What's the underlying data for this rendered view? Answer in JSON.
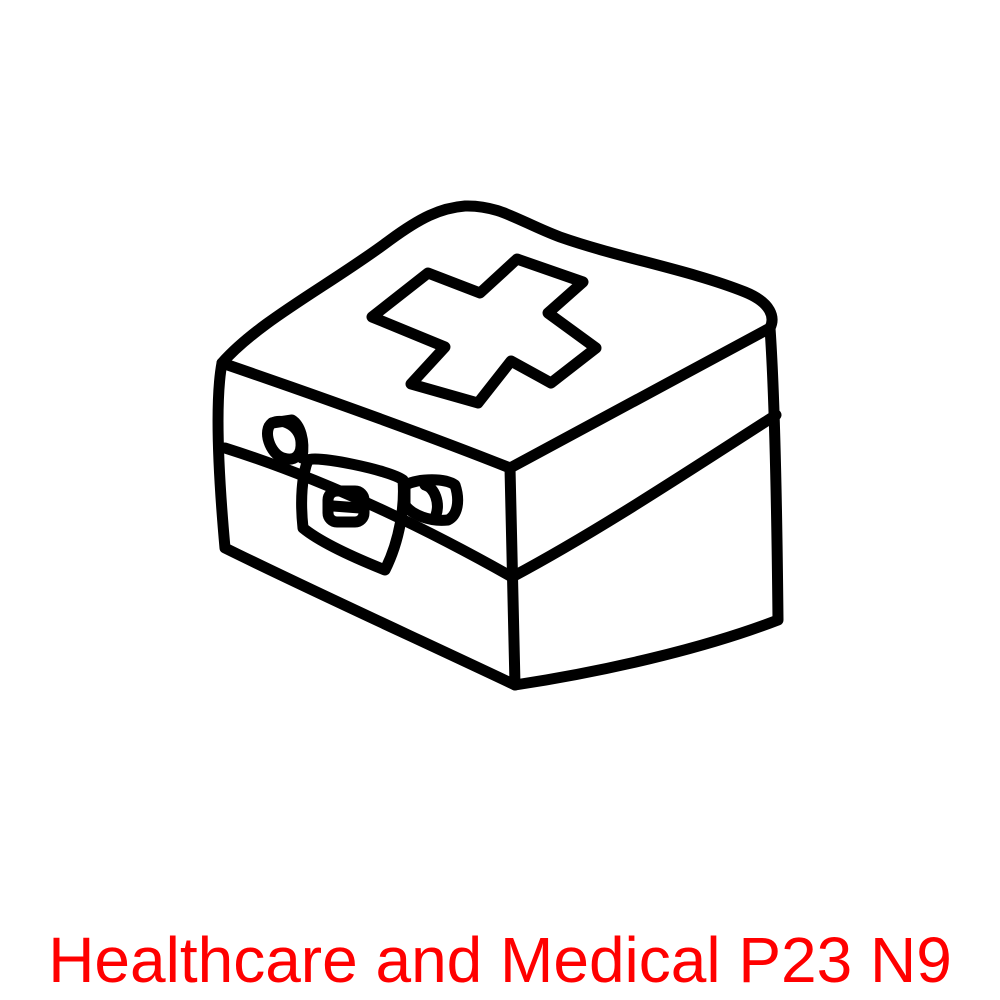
{
  "caption": {
    "text": "Healthcare and Medical P23 N9",
    "color": "#ff0000"
  },
  "illustration": {
    "icon": "first-aid-kit-icon",
    "line_color": "#000000",
    "background_color": "#ffffff"
  }
}
